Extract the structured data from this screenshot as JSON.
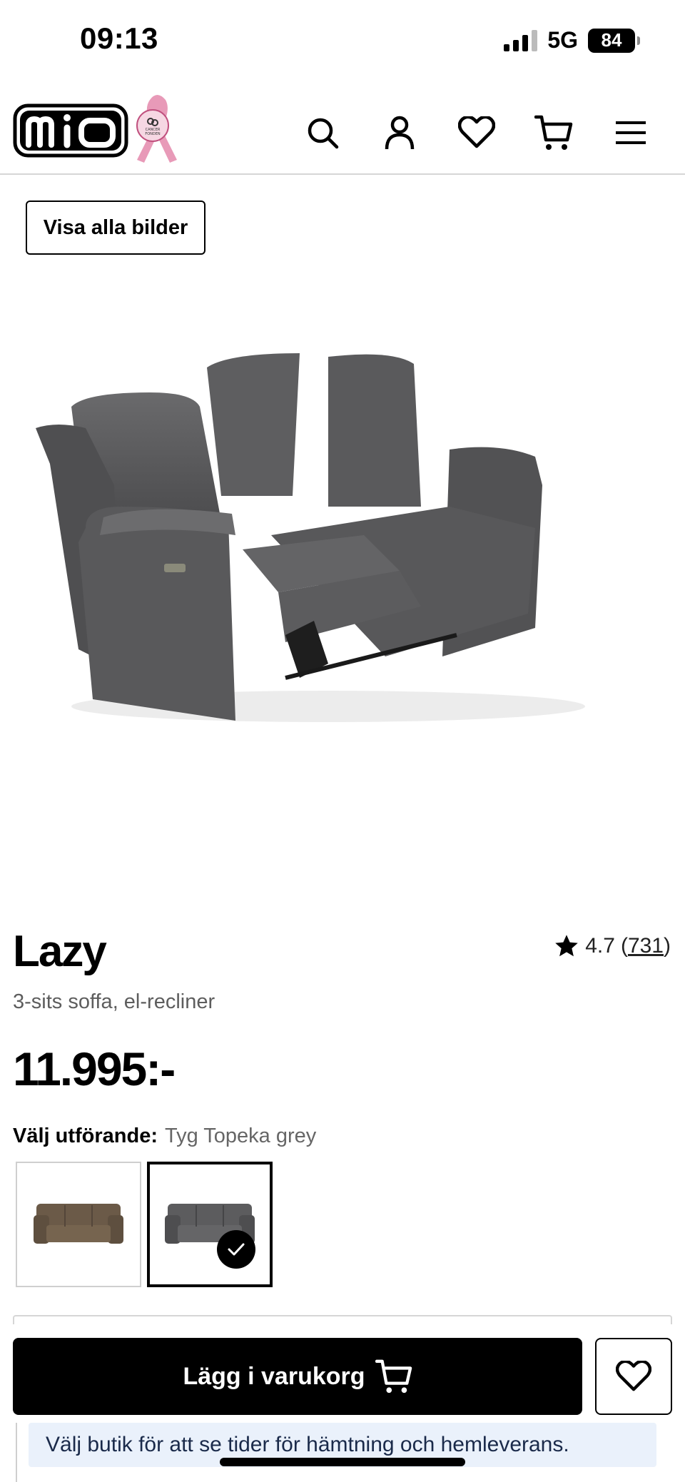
{
  "status_bar": {
    "time": "09:13",
    "network": "5G",
    "battery": "84"
  },
  "header": {
    "logo_text": "mio",
    "ribbon_text": "CANCER FONDEN",
    "icons": [
      "search-icon",
      "user-icon",
      "heart-icon",
      "cart-icon",
      "menu-icon"
    ]
  },
  "gallery": {
    "show_all_label": "Visa alla bilder"
  },
  "product": {
    "title": "Lazy",
    "subtitle": "3-sits soffa, el-recliner",
    "rating": "4.7",
    "rating_count": "731",
    "price": "11.995:-"
  },
  "variants": {
    "label": "Välj utförande:",
    "selected_value": "Tyg Topeka grey",
    "options": [
      {
        "color": "#6b5a48",
        "selected": false
      },
      {
        "color": "#5a5a5c",
        "selected": true
      }
    ]
  },
  "actions": {
    "add_to_cart_label": "Lägg i varukorg",
    "store_info": "Välj butik för att se tider för hämtning och hemleverans."
  },
  "colors": {
    "primary": "#000000",
    "sofa_grey": "#5c5c5e",
    "sofa_brown": "#6b5a48",
    "ribbon_pink": "#e89ab8",
    "info_bg": "#eaf1fb"
  }
}
